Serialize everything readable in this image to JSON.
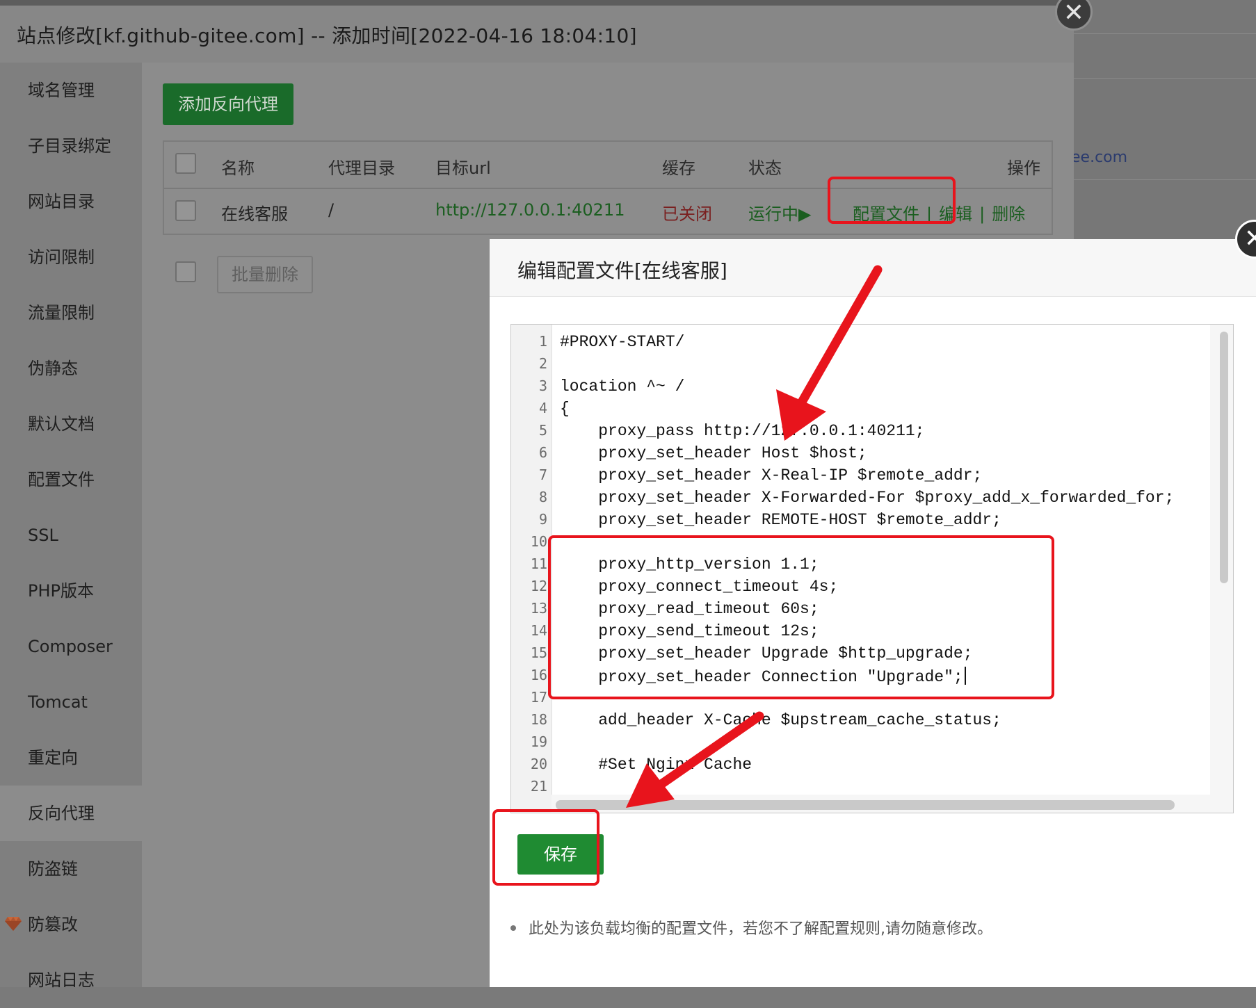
{
  "background": {
    "right_text": "ee.com"
  },
  "site_modal": {
    "title": "站点修改[kf.github-gitee.com] -- 添加时间[2022-04-16 18:04:10]",
    "close_glyph": "✕",
    "sidebar": [
      {
        "label": "域名管理"
      },
      {
        "label": "子目录绑定"
      },
      {
        "label": "网站目录"
      },
      {
        "label": "访问限制"
      },
      {
        "label": "流量限制"
      },
      {
        "label": "伪静态"
      },
      {
        "label": "默认文档"
      },
      {
        "label": "配置文件"
      },
      {
        "label": "SSL"
      },
      {
        "label": "PHP版本"
      },
      {
        "label": "Composer"
      },
      {
        "label": "Tomcat"
      },
      {
        "label": "重定向"
      },
      {
        "label": "反向代理",
        "active": true
      },
      {
        "label": "防盗链"
      },
      {
        "label": "防篡改",
        "icon": "gem-icon"
      },
      {
        "label": "网站日志"
      }
    ],
    "add_button": "添加反向代理",
    "table": {
      "headers": [
        "名称",
        "代理目录",
        "目标url",
        "缓存",
        "状态",
        "操作"
      ],
      "rows": [
        {
          "name": "在线客服",
          "dir": "/",
          "url": "http://127.0.0.1:40211",
          "cache": "已关闭",
          "status": "运行中▶",
          "actions": [
            "配置文件",
            "编辑",
            "删除"
          ],
          "separator": "|"
        }
      ]
    },
    "batch_delete": "批量删除"
  },
  "config_modal": {
    "title": "编辑配置文件[在线客服]",
    "close_glyph": "✕",
    "lines": [
      "#PROXY-START/",
      "",
      "location ^~ /",
      "{",
      "    proxy_pass http://127.0.0.1:40211;",
      "    proxy_set_header Host $host;",
      "    proxy_set_header X-Real-IP $remote_addr;",
      "    proxy_set_header X-Forwarded-For $proxy_add_x_forwarded_for;",
      "    proxy_set_header REMOTE-HOST $remote_addr;",
      "",
      "    proxy_http_version 1.1;",
      "    proxy_connect_timeout 4s;",
      "    proxy_read_timeout 60s;",
      "    proxy_send_timeout 12s;",
      "    proxy_set_header Upgrade $http_upgrade;",
      "    proxy_set_header Connection \"Upgrade\";",
      "",
      "    add_header X-Cache $upstream_cache_status;",
      "",
      "    #Set Nginx Cache",
      ""
    ],
    "save_button": "保存",
    "note": "此处为该负载均衡的配置文件，若您不了解配置规则,请勿随意修改。"
  },
  "colors": {
    "annotation_red": "#e8141c",
    "primary_green": "#1f8b32"
  }
}
